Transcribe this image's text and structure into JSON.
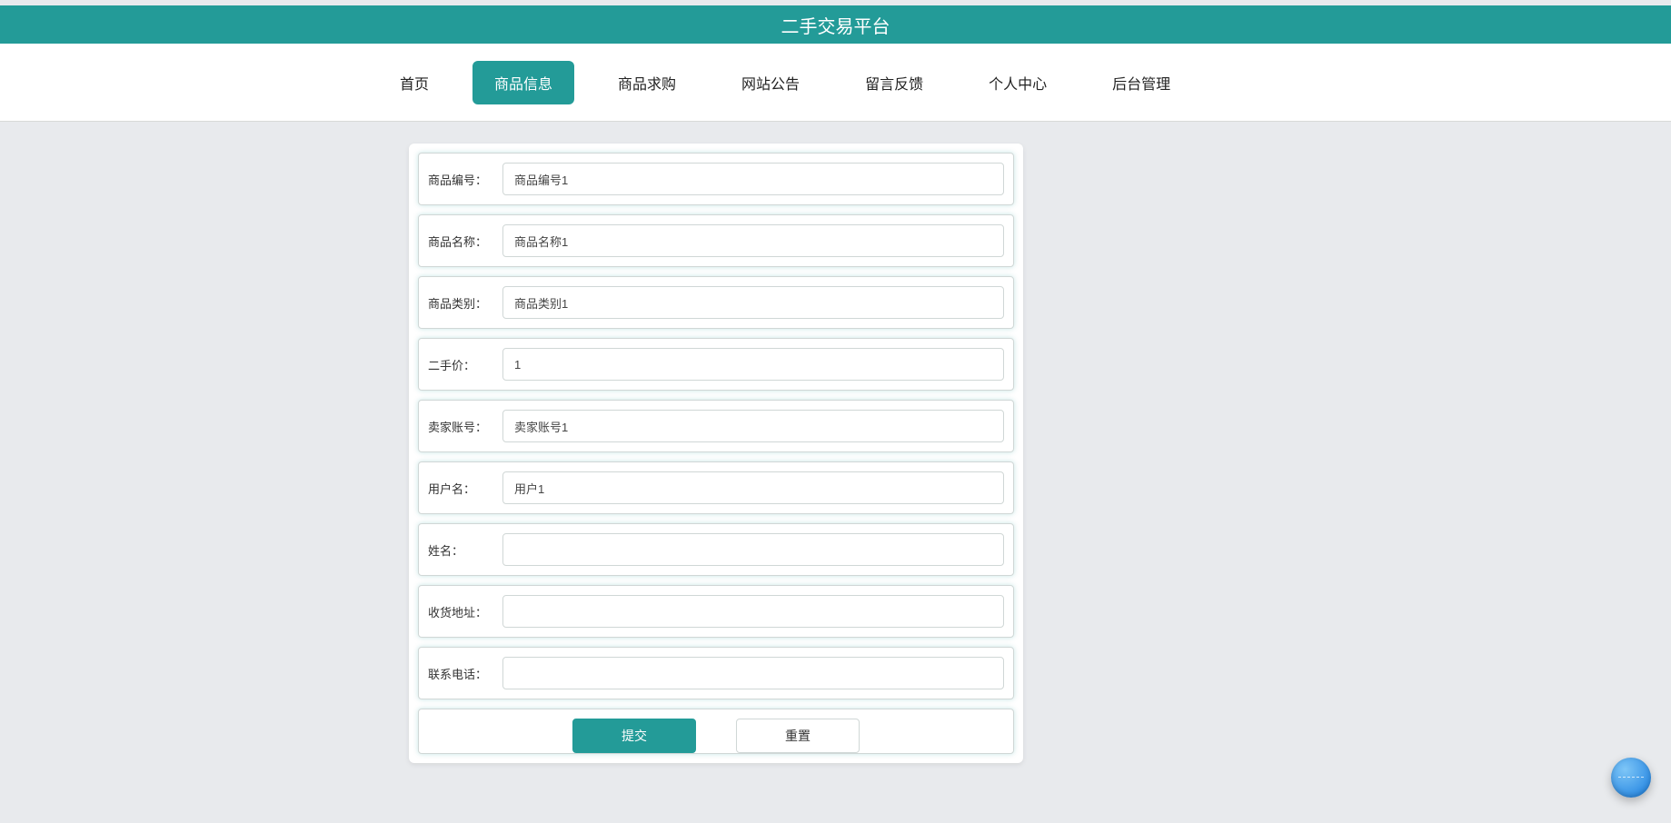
{
  "header": {
    "title": "二手交易平台"
  },
  "nav": {
    "items": [
      {
        "label": "首页",
        "active": false
      },
      {
        "label": "商品信息",
        "active": true
      },
      {
        "label": "商品求购",
        "active": false
      },
      {
        "label": "网站公告",
        "active": false
      },
      {
        "label": "留言反馈",
        "active": false
      },
      {
        "label": "个人中心",
        "active": false
      },
      {
        "label": "后台管理",
        "active": false
      }
    ]
  },
  "form": {
    "fields": [
      {
        "label": "商品编号：",
        "value": "商品编号1"
      },
      {
        "label": "商品名称：",
        "value": "商品名称1"
      },
      {
        "label": "商品类别：",
        "value": "商品类别1"
      },
      {
        "label": "二手价：",
        "value": "1"
      },
      {
        "label": "卖家账号：",
        "value": "卖家账号1"
      },
      {
        "label": "用户名：",
        "value": "用户1"
      },
      {
        "label": "姓名：",
        "value": ""
      },
      {
        "label": "收货地址：",
        "value": ""
      },
      {
        "label": "联系电话：",
        "value": ""
      }
    ],
    "submit_label": "提交",
    "reset_label": "重置"
  }
}
